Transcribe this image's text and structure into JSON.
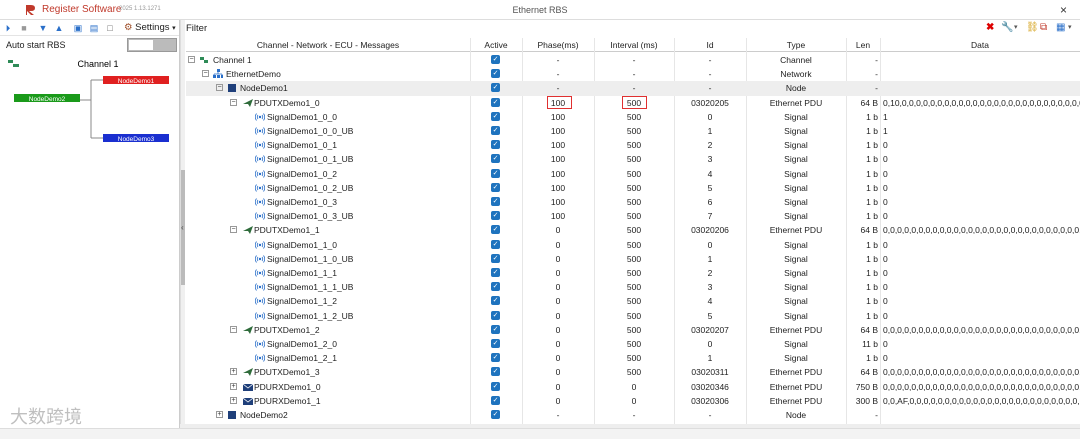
{
  "app": {
    "name": "Register Software",
    "version": "2025 1.13.1271",
    "window_title": "Ethernet RBS",
    "brand_color": "#c0392b"
  },
  "sidebar": {
    "settings_label": "Settings",
    "auto_start_label": "Auto start RBS",
    "auto_start_on": false,
    "topology": {
      "channel": "Channel 1",
      "nodes": [
        {
          "label": "NodeDemo1",
          "color": "#e02020"
        },
        {
          "label": "NodeDemo2",
          "color": "#1a9a1a"
        },
        {
          "label": "NodeDemo3",
          "color": "#1a2fd0"
        }
      ]
    }
  },
  "filter_label": "Filter",
  "columns": [
    "Channel - Network - ECU - Messages",
    "Active",
    "Phase(ms)",
    "Interval (ms)",
    "Id",
    "Type",
    "Len",
    "Data"
  ],
  "rows": [
    {
      "name": "Channel 1",
      "level": 0,
      "exp": "−",
      "icon": "channel-icon",
      "phase": "-",
      "interval": "-",
      "id": "-",
      "type": "Channel",
      "len": "-",
      "data": ""
    },
    {
      "name": "EthernetDemo",
      "level": 1,
      "exp": "−",
      "icon": "network-icon",
      "phase": "-",
      "interval": "-",
      "id": "-",
      "type": "Network",
      "len": "-",
      "data": ""
    },
    {
      "name": "NodeDemo1",
      "level": 2,
      "exp": "−",
      "icon": "node-icon",
      "phase": "-",
      "interval": "-",
      "id": "-",
      "type": "Node",
      "len": "-",
      "data": "",
      "sel": true
    },
    {
      "name": "PDUTXDemo1_0",
      "level": 3,
      "exp": "−",
      "icon": "tx-pdu-icon",
      "phase": "100",
      "interval": "500",
      "id": "03020205",
      "type": "Ethernet PDU",
      "len": "64 B",
      "data": "0,10,0,0,0,0,0,0,0,0,0,0,0,0,0,0,0,0,0,0,0,0,0,0,0,0,0,0,0,0,0,0,0,0,0",
      "boxed": true
    },
    {
      "name": "SignalDemo1_0_0",
      "level": 4,
      "icon": "signal-icon",
      "phase": "100",
      "interval": "500",
      "id": "0",
      "type": "Signal",
      "len": "1 b",
      "data": "1"
    },
    {
      "name": "SignalDemo1_0_0_UB",
      "level": 4,
      "icon": "signal-icon",
      "phase": "100",
      "interval": "500",
      "id": "1",
      "type": "Signal",
      "len": "1 b",
      "data": "1"
    },
    {
      "name": "SignalDemo1_0_1",
      "level": 4,
      "icon": "signal-icon",
      "phase": "100",
      "interval": "500",
      "id": "2",
      "type": "Signal",
      "len": "1 b",
      "data": "0"
    },
    {
      "name": "SignalDemo1_0_1_UB",
      "level": 4,
      "icon": "signal-icon",
      "phase": "100",
      "interval": "500",
      "id": "3",
      "type": "Signal",
      "len": "1 b",
      "data": "0"
    },
    {
      "name": "SignalDemo1_0_2",
      "level": 4,
      "icon": "signal-icon",
      "phase": "100",
      "interval": "500",
      "id": "4",
      "type": "Signal",
      "len": "1 b",
      "data": "0"
    },
    {
      "name": "SignalDemo1_0_2_UB",
      "level": 4,
      "icon": "signal-icon",
      "phase": "100",
      "interval": "500",
      "id": "5",
      "type": "Signal",
      "len": "1 b",
      "data": "0"
    },
    {
      "name": "SignalDemo1_0_3",
      "level": 4,
      "icon": "signal-icon",
      "phase": "100",
      "interval": "500",
      "id": "6",
      "type": "Signal",
      "len": "1 b",
      "data": "0"
    },
    {
      "name": "SignalDemo1_0_3_UB",
      "level": 4,
      "icon": "signal-icon",
      "phase": "100",
      "interval": "500",
      "id": "7",
      "type": "Signal",
      "len": "1 b",
      "data": "0"
    },
    {
      "name": "PDUTXDemo1_1",
      "level": 3,
      "exp": "−",
      "icon": "tx-pdu-icon",
      "phase": "0",
      "interval": "500",
      "id": "03020206",
      "type": "Ethernet PDU",
      "len": "64 B",
      "data": "0,0,0,0,0,0,0,0,0,0,0,0,0,0,0,0,0,0,0,0,0,0,0,0,0,0,0,0,0,0,0,0,0,0,0,0"
    },
    {
      "name": "SignalDemo1_1_0",
      "level": 4,
      "icon": "signal-icon",
      "phase": "0",
      "interval": "500",
      "id": "0",
      "type": "Signal",
      "len": "1 b",
      "data": "0"
    },
    {
      "name": "SignalDemo1_1_0_UB",
      "level": 4,
      "icon": "signal-icon",
      "phase": "0",
      "interval": "500",
      "id": "1",
      "type": "Signal",
      "len": "1 b",
      "data": "0"
    },
    {
      "name": "SignalDemo1_1_1",
      "level": 4,
      "icon": "signal-icon",
      "phase": "0",
      "interval": "500",
      "id": "2",
      "type": "Signal",
      "len": "1 b",
      "data": "0"
    },
    {
      "name": "SignalDemo1_1_1_UB",
      "level": 4,
      "icon": "signal-icon",
      "phase": "0",
      "interval": "500",
      "id": "3",
      "type": "Signal",
      "len": "1 b",
      "data": "0"
    },
    {
      "name": "SignalDemo1_1_2",
      "level": 4,
      "icon": "signal-icon",
      "phase": "0",
      "interval": "500",
      "id": "4",
      "type": "Signal",
      "len": "1 b",
      "data": "0"
    },
    {
      "name": "SignalDemo1_1_2_UB",
      "level": 4,
      "icon": "signal-icon",
      "phase": "0",
      "interval": "500",
      "id": "5",
      "type": "Signal",
      "len": "1 b",
      "data": "0"
    },
    {
      "name": "PDUTXDemo1_2",
      "level": 3,
      "exp": "−",
      "icon": "tx-pdu-icon",
      "phase": "0",
      "interval": "500",
      "id": "03020207",
      "type": "Ethernet PDU",
      "len": "64 B",
      "data": "0,0,0,0,0,0,0,0,0,0,0,0,0,0,0,0,0,0,0,0,0,0,0,0,0,0,0,0,0,0,0,0,0,0,0,0"
    },
    {
      "name": "SignalDemo1_2_0",
      "level": 4,
      "icon": "signal-icon",
      "phase": "0",
      "interval": "500",
      "id": "0",
      "type": "Signal",
      "len": "11 b",
      "data": "0"
    },
    {
      "name": "SignalDemo1_2_1",
      "level": 4,
      "icon": "signal-icon",
      "phase": "0",
      "interval": "500",
      "id": "1",
      "type": "Signal",
      "len": "1 b",
      "data": "0"
    },
    {
      "name": "PDUTXDemo1_3",
      "level": 3,
      "exp": "+",
      "icon": "tx-pdu-icon",
      "phase": "0",
      "interval": "500",
      "id": "03020311",
      "type": "Ethernet PDU",
      "len": "64 B",
      "data": "0,0,0,0,0,0,0,0,0,0,0,0,0,0,0,0,0,0,0,0,0,0,0,0,0,0,0,0,0,0,0,0,0,0,0,0"
    },
    {
      "name": "PDURXDemo1_0",
      "level": 3,
      "exp": "+",
      "icon": "rx-pdu-icon",
      "phase": "0",
      "interval": "0",
      "id": "03020346",
      "type": "Ethernet PDU",
      "len": "750 B",
      "data": "0,0,0,0,0,0,0,0,0,0,0,0,0,0,0,0,0,0,0,0,0,0,0,0,0,0,0,0,0,0,0,0,0,0,0,0"
    },
    {
      "name": "PDURXDemo1_1",
      "level": 3,
      "exp": "+",
      "icon": "rx-pdu-icon",
      "phase": "0",
      "interval": "0",
      "id": "03020306",
      "type": "Ethernet PDU",
      "len": "300 B",
      "data": "0,0,AF,0,0,0,0,0,0,0,0,0,0,0,0,0,0,0,0,0,0,0,0,0,0,0,0,0,0,0,0,0,0,0,0"
    },
    {
      "name": "NodeDemo2",
      "level": 2,
      "exp": "+",
      "icon": "node-icon",
      "phase": "-",
      "interval": "-",
      "id": "-",
      "type": "Node",
      "len": "-",
      "data": ""
    }
  ],
  "watermark": "大数跨境"
}
